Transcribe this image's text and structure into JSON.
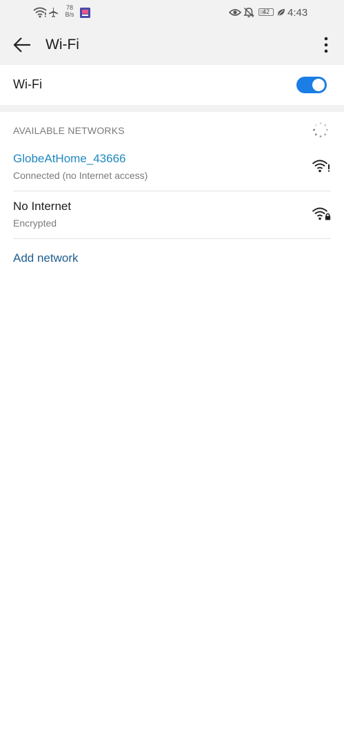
{
  "status_bar": {
    "speed_value": "78",
    "speed_unit": "B/s",
    "battery": "42",
    "battery_level": 0.42,
    "time": "4:43"
  },
  "header": {
    "title": "Wi-Fi"
  },
  "wifi_toggle": {
    "label": "Wi-Fi",
    "enabled": true,
    "accent_color": "#1a7ee5"
  },
  "networks": {
    "section_title": "AVAILABLE NETWORKS",
    "items": [
      {
        "name": "GlobeAtHome_43666",
        "status": "Connected (no Internet access)",
        "connected": true,
        "icon": "wifi-no-internet-icon"
      },
      {
        "name": "No Internet",
        "status": "Encrypted",
        "connected": false,
        "icon": "wifi-locked-icon"
      }
    ],
    "add_network_label": "Add network"
  },
  "colors": {
    "connected_name": "#1f88c0",
    "default_name": "#1c1c1c",
    "secondary_text": "#7a7a7a",
    "link": "#1f5e8f"
  }
}
